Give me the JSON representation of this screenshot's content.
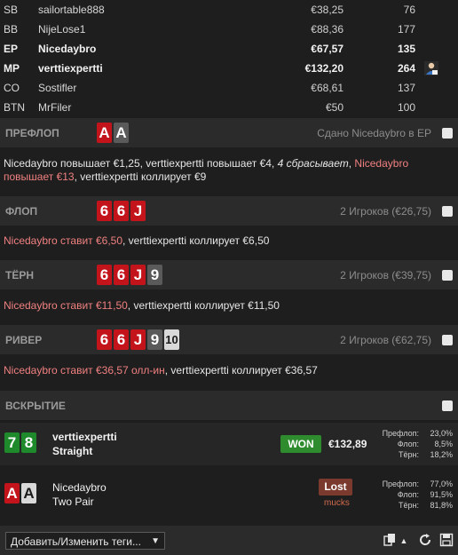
{
  "players": [
    {
      "pos": "SB",
      "name": "sailortable888",
      "stack": "€38,25",
      "bb": "76",
      "bold": false
    },
    {
      "pos": "BB",
      "name": "NijeLose1",
      "stack": "€88,36",
      "bb": "177",
      "bold": false
    },
    {
      "pos": "EP",
      "name": "Nicedaybro",
      "stack": "€67,57",
      "bb": "135",
      "bold": true
    },
    {
      "pos": "MP",
      "name": "verttiexpertti",
      "stack": "€132,20",
      "bb": "264",
      "bold": true
    },
    {
      "pos": "CO",
      "name": "Sostifler",
      "stack": "€68,61",
      "bb": "137",
      "bold": false
    },
    {
      "pos": "BTN",
      "name": "MrFiler",
      "stack": "€50",
      "bb": "100",
      "bold": false
    }
  ],
  "preflop": {
    "title": "ПРЕФЛОП",
    "info": "Сдано Nicedaybro в EP",
    "cards": [
      "A",
      "A"
    ],
    "actions": [
      {
        "t": "Nicedaybro повышает €1,25, verttiexpertti повышает €4, ",
        "s": ""
      },
      {
        "t": "4 сбрасывает",
        "s": "it"
      },
      {
        "t": ", ",
        "s": ""
      },
      {
        "t": "Nicedaybro повышает €13",
        "s": "red"
      },
      {
        "t": ", verttiexpertti коллирует €9",
        "s": ""
      }
    ]
  },
  "flop": {
    "title": "ФЛОП",
    "info": "2 Игроков (€26,75)",
    "cards": [
      "6",
      "6",
      "J"
    ],
    "actions": [
      {
        "t": "Nicedaybro ставит €6,50",
        "s": "red"
      },
      {
        "t": ", verttiexpertti коллирует €6,50",
        "s": ""
      }
    ]
  },
  "turn": {
    "title": "ТЁРН",
    "info": "2 Игроков (€39,75)",
    "cards": [
      "6",
      "6",
      "J",
      "9"
    ],
    "actions": [
      {
        "t": "Nicedaybro ставит €11,50",
        "s": "red"
      },
      {
        "t": ", verttiexpertti коллирует €11,50",
        "s": ""
      }
    ]
  },
  "river": {
    "title": "РИВЕР",
    "info": "2 Игроков (€62,75)",
    "cards": [
      "6",
      "6",
      "J",
      "9",
      "10"
    ],
    "actions": [
      {
        "t": "Nicedaybro ставит €36,57 олл-ин",
        "s": "red"
      },
      {
        "t": ", verttiexpertti коллирует €36,57",
        "s": ""
      }
    ]
  },
  "showdown": {
    "title": "ВСКРЫТИЕ",
    "winner": {
      "cards": [
        "7",
        "8"
      ],
      "name": "verttiexpertti",
      "hand": "Straight",
      "badge": "WON",
      "amount": "€132,89",
      "equity": [
        {
          "label": "Префлоп:",
          "value": "23,0%"
        },
        {
          "label": "Флоп:",
          "value": "8,5%"
        },
        {
          "label": "Тёрн:",
          "value": "18,2%"
        }
      ]
    },
    "loser": {
      "cards": [
        "A",
        "A"
      ],
      "name": "Nicedaybro",
      "hand": "Two Pair",
      "badge": "Lost",
      "sub": "mucks",
      "equity": [
        {
          "label": "Префлоп:",
          "value": "77,0%"
        },
        {
          "label": "Флоп:",
          "value": "91,5%"
        },
        {
          "label": "Тёрн:",
          "value": "81,8%"
        }
      ]
    }
  },
  "bottom": {
    "tags_label": "Добавить/Изменить теги...",
    "icons": [
      "copy-icon",
      "refresh-icon",
      "save-icon"
    ]
  }
}
